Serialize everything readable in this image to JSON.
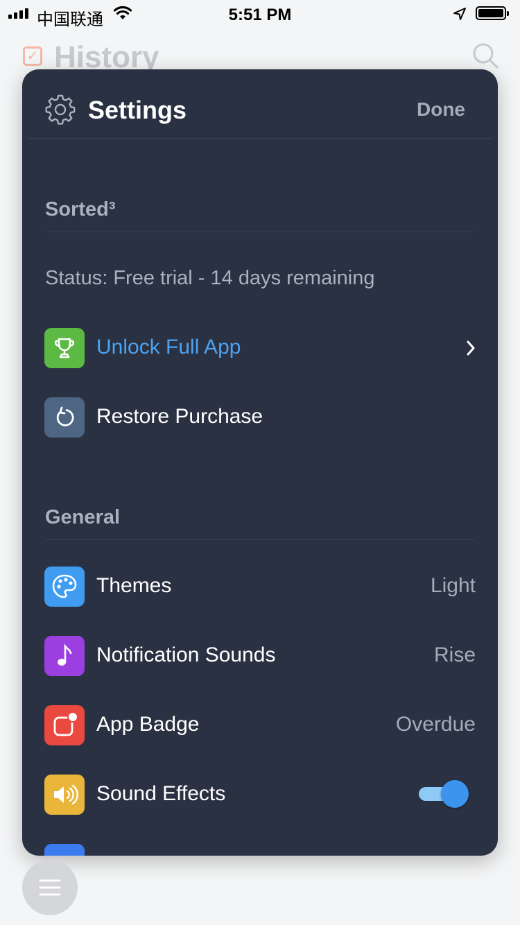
{
  "status_bar": {
    "carrier": "中国联通",
    "time": "5:51 PM"
  },
  "background": {
    "title": "History"
  },
  "settings": {
    "title": "Settings",
    "done_label": "Done",
    "sections": {
      "sorted": {
        "title": "Sorted³",
        "status": "Status: Free trial - 14 days remaining",
        "unlock_label": "Unlock Full App",
        "restore_label": "Restore Purchase"
      },
      "general": {
        "title": "General",
        "themes": {
          "label": "Themes",
          "value": "Light"
        },
        "notification_sounds": {
          "label": "Notification Sounds",
          "value": "Rise"
        },
        "app_badge": {
          "label": "App Badge",
          "value": "Overdue"
        },
        "sound_effects": {
          "label": "Sound Effects",
          "enabled": true
        }
      }
    }
  },
  "colors": {
    "panel_bg": "#293142",
    "accent_blue": "#4da3f2",
    "trophy_green": "#5cb943",
    "restore_slate": "#4e6584",
    "themes_blue": "#3f9cf0",
    "sounds_purple": "#9b3fe0",
    "badge_red": "#e9493e",
    "effects_yellow": "#e9b53a"
  },
  "icons": {
    "settings": "gear-icon",
    "unlock": "trophy-icon",
    "restore": "restore-arrow-icon",
    "themes": "palette-icon",
    "notification_sounds": "music-note-icon",
    "app_badge": "badge-icon",
    "sound_effects": "speaker-icon",
    "menu": "hamburger-menu-icon"
  }
}
